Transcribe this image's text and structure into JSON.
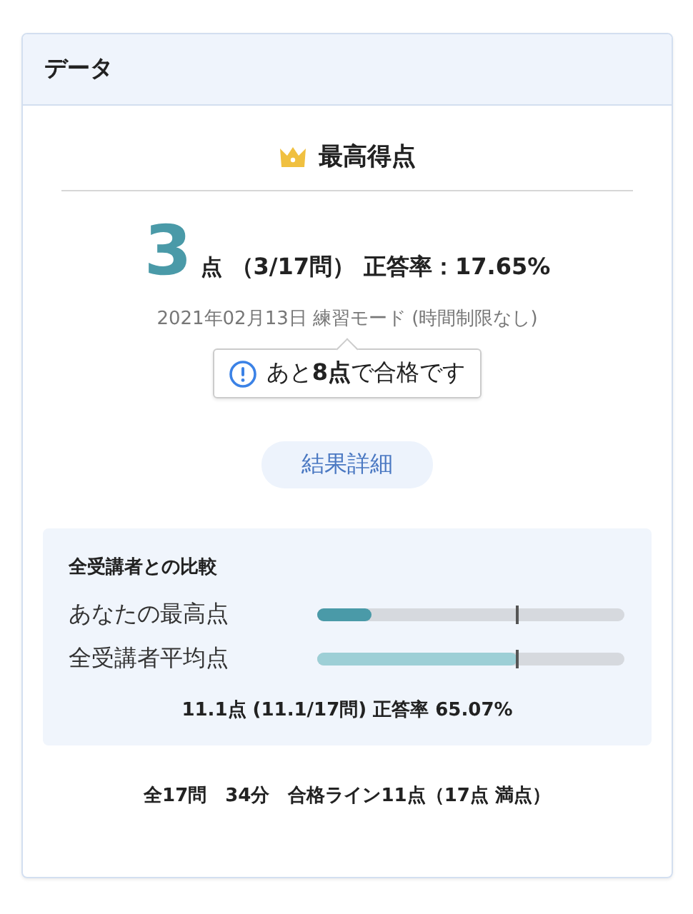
{
  "card": {
    "title": "データ"
  },
  "best": {
    "title": "最高得点",
    "score": "3",
    "unit": "点",
    "detail": "（3/17問）",
    "rate": "正答率：17.65%",
    "meta": "2021年02月13日 練習モード (時間制限なし)",
    "tip": "あと**8点**で合格です",
    "button": "結果詳細"
  },
  "comparison": {
    "title": "全受講者との比較",
    "rows": [
      {
        "label": "あなたの最高点",
        "kind": "mine",
        "level": 0.1765,
        "marker": {
          "level": 0.647
        }
      },
      {
        "label": "全受講者平均点",
        "kind": "average",
        "level": 0.6507,
        "marker": {
          "level": 0.647
        }
      }
    ],
    "summary": "11.1点 (11.1/17問) 正答率 65.07%"
  },
  "footer": "全17問　34分　合格ライン11点（17点 満点）"
}
